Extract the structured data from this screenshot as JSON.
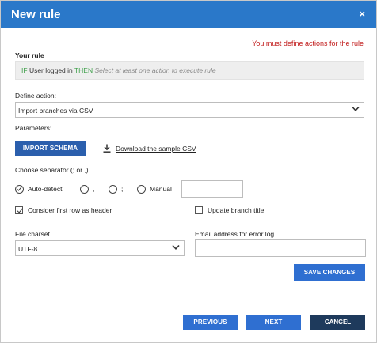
{
  "dialog": {
    "title": "New rule",
    "close_glyph": "×",
    "error_message": "You must define actions for the rule"
  },
  "rule": {
    "section_label": "Your rule",
    "if_keyword": "IF",
    "condition": "User logged in",
    "then_keyword": "THEN",
    "placeholder": "Select at least one action to execute rule"
  },
  "action": {
    "label": "Define action:",
    "selected": "Import branches via CSV"
  },
  "parameters": {
    "label": "Parameters:",
    "import_schema_button": "IMPORT SCHEMA",
    "download_link": "Download the sample CSV",
    "separator_label": "Choose separator (; or ,)",
    "separator_options": [
      {
        "label": "Auto-detect",
        "checked": true
      },
      {
        "label": ",",
        "checked": false
      },
      {
        "label": ";",
        "checked": false
      },
      {
        "label": "Manual",
        "checked": false
      }
    ],
    "manual_value": "",
    "first_row_header_label": "Consider first row as header",
    "first_row_header_checked": true,
    "update_branch_title_label": "Update branch title",
    "update_branch_title_checked": false,
    "charset_label": "File charset",
    "charset_value": "UTF-8",
    "email_label": "Email address for error log",
    "email_value": "",
    "save_button": "SAVE CHANGES"
  },
  "footer": {
    "previous_button": "PREVIOUS",
    "next_button": "NEXT",
    "cancel_button": "CANCEL"
  },
  "colors": {
    "header": "#2a78c9",
    "primary_button": "#2f6fd1",
    "cancel_button": "#1e3a5c",
    "error_text": "#c01818",
    "keyword": "#3fa04b"
  },
  "icons": {
    "close": "close-icon",
    "chevron": "chevron-down-icon",
    "download": "download-icon",
    "check": "check-icon"
  }
}
